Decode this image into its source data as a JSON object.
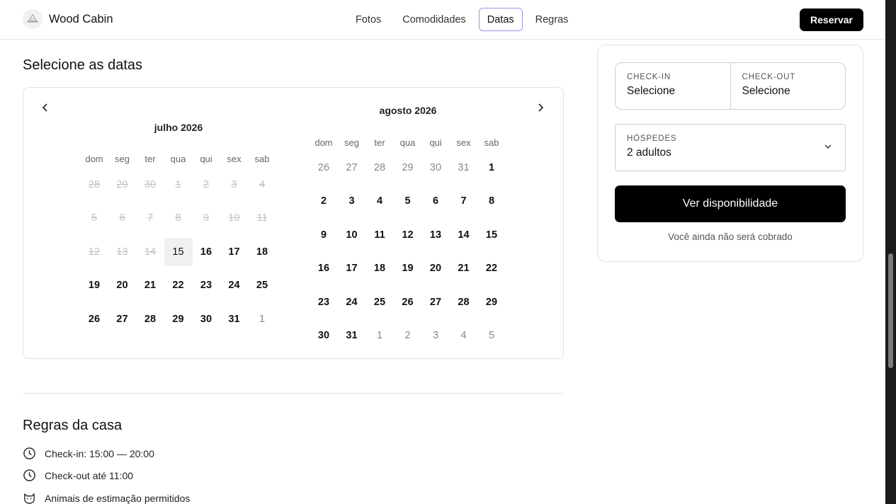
{
  "header": {
    "brand": "Wood Cabin",
    "nav": [
      "Fotos",
      "Comodidades",
      "Datas",
      "Regras"
    ],
    "active_nav": "Datas",
    "reserve_label": "Reservar"
  },
  "dates_section": {
    "title": "Selecione as datas",
    "weekdays": [
      "dom",
      "seg",
      "ter",
      "qua",
      "qui",
      "sex",
      "sab"
    ],
    "months": [
      {
        "title": "julho 2026",
        "weeks": [
          [
            {
              "d": "28",
              "s": "past"
            },
            {
              "d": "29",
              "s": "past"
            },
            {
              "d": "30",
              "s": "past"
            },
            {
              "d": "1",
              "s": "past"
            },
            {
              "d": "2",
              "s": "past"
            },
            {
              "d": "3",
              "s": "past"
            },
            {
              "d": "4",
              "s": "past"
            }
          ],
          [
            {
              "d": "5",
              "s": "past"
            },
            {
              "d": "6",
              "s": "past"
            },
            {
              "d": "7",
              "s": "past"
            },
            {
              "d": "8",
              "s": "past"
            },
            {
              "d": "9",
              "s": "past"
            },
            {
              "d": "10",
              "s": "past"
            },
            {
              "d": "11",
              "s": "past"
            }
          ],
          [
            {
              "d": "12",
              "s": "past"
            },
            {
              "d": "13",
              "s": "past"
            },
            {
              "d": "14",
              "s": "past"
            },
            {
              "d": "15",
              "s": "today"
            },
            {
              "d": "16",
              "s": "avail"
            },
            {
              "d": "17",
              "s": "avail"
            },
            {
              "d": "18",
              "s": "avail"
            }
          ],
          [
            {
              "d": "19",
              "s": "avail"
            },
            {
              "d": "20",
              "s": "avail"
            },
            {
              "d": "21",
              "s": "avail"
            },
            {
              "d": "22",
              "s": "avail"
            },
            {
              "d": "23",
              "s": "avail"
            },
            {
              "d": "24",
              "s": "avail"
            },
            {
              "d": "25",
              "s": "avail"
            }
          ],
          [
            {
              "d": "26",
              "s": "avail"
            },
            {
              "d": "27",
              "s": "avail"
            },
            {
              "d": "28",
              "s": "avail"
            },
            {
              "d": "29",
              "s": "avail"
            },
            {
              "d": "30",
              "s": "avail"
            },
            {
              "d": "31",
              "s": "avail"
            },
            {
              "d": "1",
              "s": "other"
            }
          ]
        ]
      },
      {
        "title": "agosto 2026",
        "weeks": [
          [
            {
              "d": "26",
              "s": "other"
            },
            {
              "d": "27",
              "s": "other"
            },
            {
              "d": "28",
              "s": "other"
            },
            {
              "d": "29",
              "s": "other"
            },
            {
              "d": "30",
              "s": "other"
            },
            {
              "d": "31",
              "s": "other"
            },
            {
              "d": "1",
              "s": "avail"
            }
          ],
          [
            {
              "d": "2",
              "s": "avail"
            },
            {
              "d": "3",
              "s": "avail"
            },
            {
              "d": "4",
              "s": "avail"
            },
            {
              "d": "5",
              "s": "avail"
            },
            {
              "d": "6",
              "s": "avail"
            },
            {
              "d": "7",
              "s": "avail"
            },
            {
              "d": "8",
              "s": "avail"
            }
          ],
          [
            {
              "d": "9",
              "s": "avail"
            },
            {
              "d": "10",
              "s": "avail"
            },
            {
              "d": "11",
              "s": "avail"
            },
            {
              "d": "12",
              "s": "avail"
            },
            {
              "d": "13",
              "s": "avail"
            },
            {
              "d": "14",
              "s": "avail"
            },
            {
              "d": "15",
              "s": "avail"
            }
          ],
          [
            {
              "d": "16",
              "s": "avail"
            },
            {
              "d": "17",
              "s": "avail"
            },
            {
              "d": "18",
              "s": "avail"
            },
            {
              "d": "19",
              "s": "avail"
            },
            {
              "d": "20",
              "s": "avail"
            },
            {
              "d": "21",
              "s": "avail"
            },
            {
              "d": "22",
              "s": "avail"
            }
          ],
          [
            {
              "d": "23",
              "s": "avail"
            },
            {
              "d": "24",
              "s": "avail"
            },
            {
              "d": "25",
              "s": "avail"
            },
            {
              "d": "26",
              "s": "avail"
            },
            {
              "d": "27",
              "s": "avail"
            },
            {
              "d": "28",
              "s": "avail"
            },
            {
              "d": "29",
              "s": "avail"
            }
          ],
          [
            {
              "d": "30",
              "s": "avail"
            },
            {
              "d": "31",
              "s": "avail"
            },
            {
              "d": "1",
              "s": "other"
            },
            {
              "d": "2",
              "s": "other"
            },
            {
              "d": "3",
              "s": "other"
            },
            {
              "d": "4",
              "s": "other"
            },
            {
              "d": "5",
              "s": "other"
            }
          ]
        ]
      }
    ],
    "prev_icon": "chevron-left-icon",
    "next_icon": "chevron-right-icon"
  },
  "rules_section": {
    "title": "Regras da casa",
    "items": [
      {
        "icon": "clock-icon",
        "text": "Check-in: 15:00 — 20:00"
      },
      {
        "icon": "clock-icon",
        "text": "Check-out até 11:00"
      },
      {
        "icon": "cat-icon",
        "text": "Animais de estimação permitidos"
      }
    ]
  },
  "booking": {
    "checkin_label": "CHECK-IN",
    "checkin_value": "Selecione",
    "checkout_label": "CHECK-OUT",
    "checkout_value": "Selecione",
    "guests_label": "HÓSPEDES",
    "guests_value": "2 adultos",
    "button_label": "Ver disponibilidade",
    "note": "Você ainda não será cobrado"
  }
}
